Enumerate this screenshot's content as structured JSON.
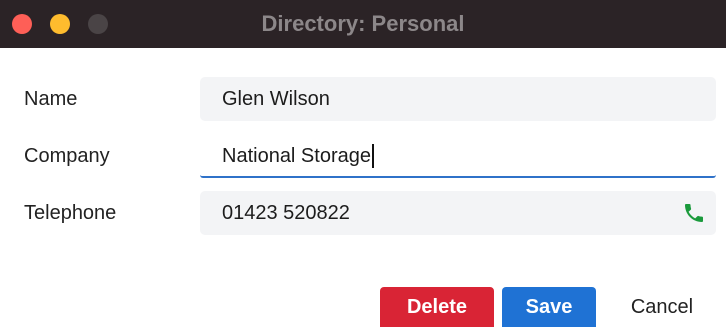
{
  "window": {
    "title": "Directory: Personal"
  },
  "form": {
    "name": {
      "label": "Name",
      "value": "Glen Wilson"
    },
    "company": {
      "label": "Company",
      "value": "National Storage"
    },
    "telephone": {
      "label": "Telephone",
      "value": "01423 520822",
      "icon": "phone-icon"
    }
  },
  "buttons": {
    "delete": "Delete",
    "save": "Save",
    "cancel": "Cancel"
  },
  "colors": {
    "titlebar": "#2b2326",
    "delete": "#d92435",
    "save": "#1f72d4",
    "focus": "#2f72c9",
    "phone": "#1a9a3c"
  }
}
